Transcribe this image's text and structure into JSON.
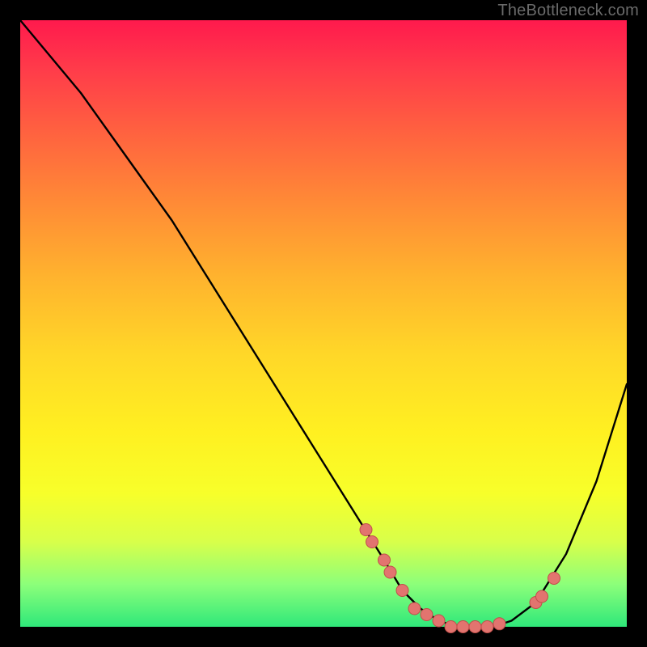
{
  "attribution": "TheBottleneck.com",
  "chart_data": {
    "type": "line",
    "title": "",
    "xlabel": "",
    "ylabel": "",
    "xlim": [
      0,
      100
    ],
    "ylim": [
      0,
      100
    ],
    "series": [
      {
        "name": "bottleneck-curve",
        "x": [
          0,
          5,
          10,
          15,
          20,
          25,
          30,
          35,
          40,
          45,
          50,
          55,
          60,
          63,
          66,
          69,
          72,
          75,
          78,
          81,
          85,
          90,
          95,
          100
        ],
        "y": [
          100,
          94,
          88,
          81,
          74,
          67,
          59,
          51,
          43,
          35,
          27,
          19,
          11,
          6,
          3,
          1,
          0,
          0,
          0,
          1,
          4,
          12,
          24,
          40
        ]
      }
    ],
    "markers": {
      "name": "highlight-points",
      "x": [
        57,
        58,
        60,
        61,
        63,
        65,
        67,
        69,
        71,
        73,
        75,
        77,
        79,
        85,
        86,
        88
      ],
      "y": [
        16,
        14,
        11,
        9,
        6,
        3,
        2,
        1,
        0,
        0,
        0,
        0,
        0.5,
        4,
        5,
        8
      ]
    },
    "colors": {
      "curve": "#000000",
      "marker_fill": "#e2746f",
      "marker_stroke": "#c04e4a"
    }
  }
}
